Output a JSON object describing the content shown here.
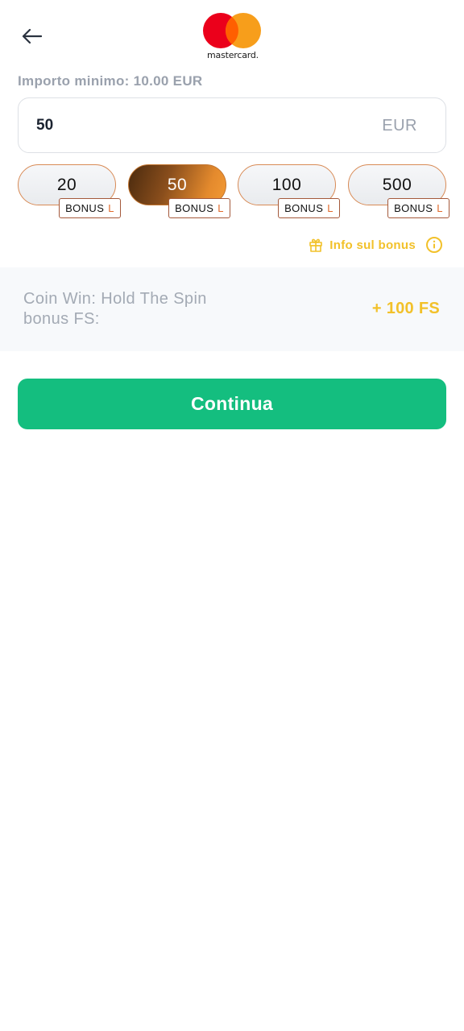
{
  "header": {
    "back_icon": "arrow-left-icon",
    "logo_icon": "mastercard-logo",
    "logo_text": "mastercard.",
    "colors": {
      "red": "#eb001b",
      "orange": "#f79e1b",
      "overlap": "#ff5f00"
    }
  },
  "amount": {
    "min_label": "Importo minimo: 10.00 EUR",
    "value": "50",
    "currency": "EUR"
  },
  "chips": [
    {
      "value": "20",
      "badge": "BONUS",
      "badge_suffix": "L",
      "selected": false
    },
    {
      "value": "50",
      "badge": "BONUS",
      "badge_suffix": "L",
      "selected": true
    },
    {
      "value": "100",
      "badge": "BONUS",
      "badge_suffix": "L",
      "selected": false
    },
    {
      "value": "500",
      "badge": "BONUS",
      "badge_suffix": "L",
      "selected": false
    }
  ],
  "bonus_info": {
    "gift_icon": "gift-icon",
    "label": "Info sul bonus",
    "info_icon": "info-circle-icon"
  },
  "bonus_panel": {
    "label": "Coin Win: Hold The Spin bonus FS:",
    "value": "+ 100 FS"
  },
  "actions": {
    "continue_label": "Continua",
    "accent": "#14be7f",
    "highlight": "#f2c12a"
  }
}
